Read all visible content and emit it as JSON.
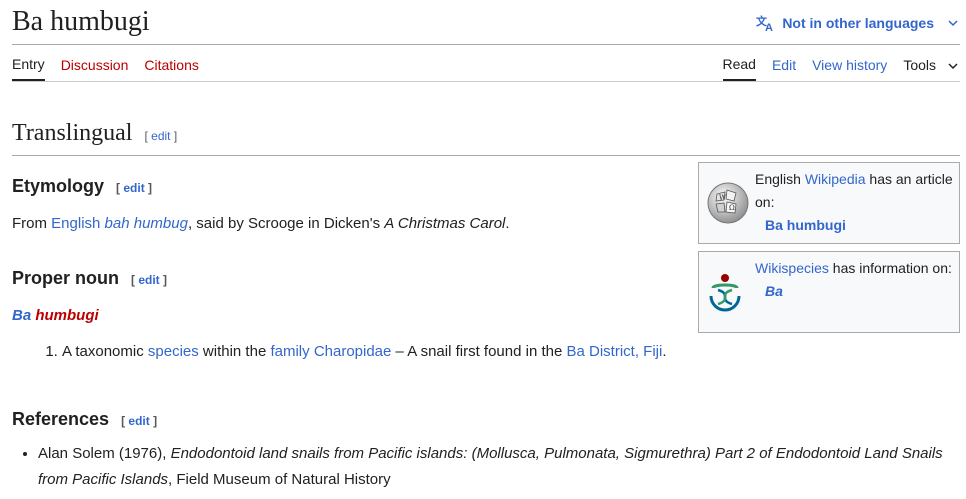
{
  "page": {
    "title": "Ba humbugi",
    "language_button": "Not in other languages"
  },
  "tabs": {
    "left": [
      "Entry",
      "Discussion",
      "Citations"
    ],
    "right": [
      "Read",
      "Edit",
      "View history",
      "Tools"
    ]
  },
  "edit_link": {
    "open": "[",
    "label": "edit",
    "close": "]"
  },
  "sections": {
    "translingual": "Translingual",
    "etymology": {
      "heading": "Etymology",
      "text_from": "From ",
      "link_english": "English",
      "term_link": "bah humbug",
      "text_mid": ", said by Scrooge in Dicken's ",
      "title_italic": "A Christmas Carol",
      "text_end": "."
    },
    "proper_noun": {
      "heading": "Proper noun",
      "headword_part1": "Ba",
      "headword_part2": "humbugi",
      "definition": {
        "number": "1.",
        "text_a": "A taxonomic ",
        "link_species": "species",
        "text_b": " within the ",
        "link_family": "family",
        "text_c": " ",
        "link_charopidae": "Charopidae",
        "text_d": " – A snail first found in the ",
        "link_ba_district": "Ba District, Fiji",
        "text_e": "."
      }
    },
    "references": {
      "heading": "References",
      "item": {
        "author": "Alan Solem (1976), ",
        "title_italic": "Endodontoid land snails from Pacific islands: (Mollusca, Pulmonata, Sigmurethra) Part 2 of Endodontoid Land Snails from Pacific Islands",
        "publisher": ", Field Museum of Natural History"
      }
    }
  },
  "sidebar": {
    "wikipedia": {
      "text_pre": "English ",
      "link": "Wikipedia",
      "text_post": " has an article on:",
      "target": "Ba humbugi"
    },
    "wikispecies": {
      "link": "Wikispecies",
      "text_post": " has information on:",
      "target": "Ba"
    }
  },
  "colors": {
    "link": "#3366cc",
    "redlink": "#ba0000",
    "text": "#202122",
    "box_bg": "#f8f9fa",
    "box_border": "#aaaaaa"
  },
  "icons": [
    "translate-icon",
    "chevron-down-icon",
    "wikipedia-globe-icon",
    "wikispecies-logo-icon"
  ]
}
